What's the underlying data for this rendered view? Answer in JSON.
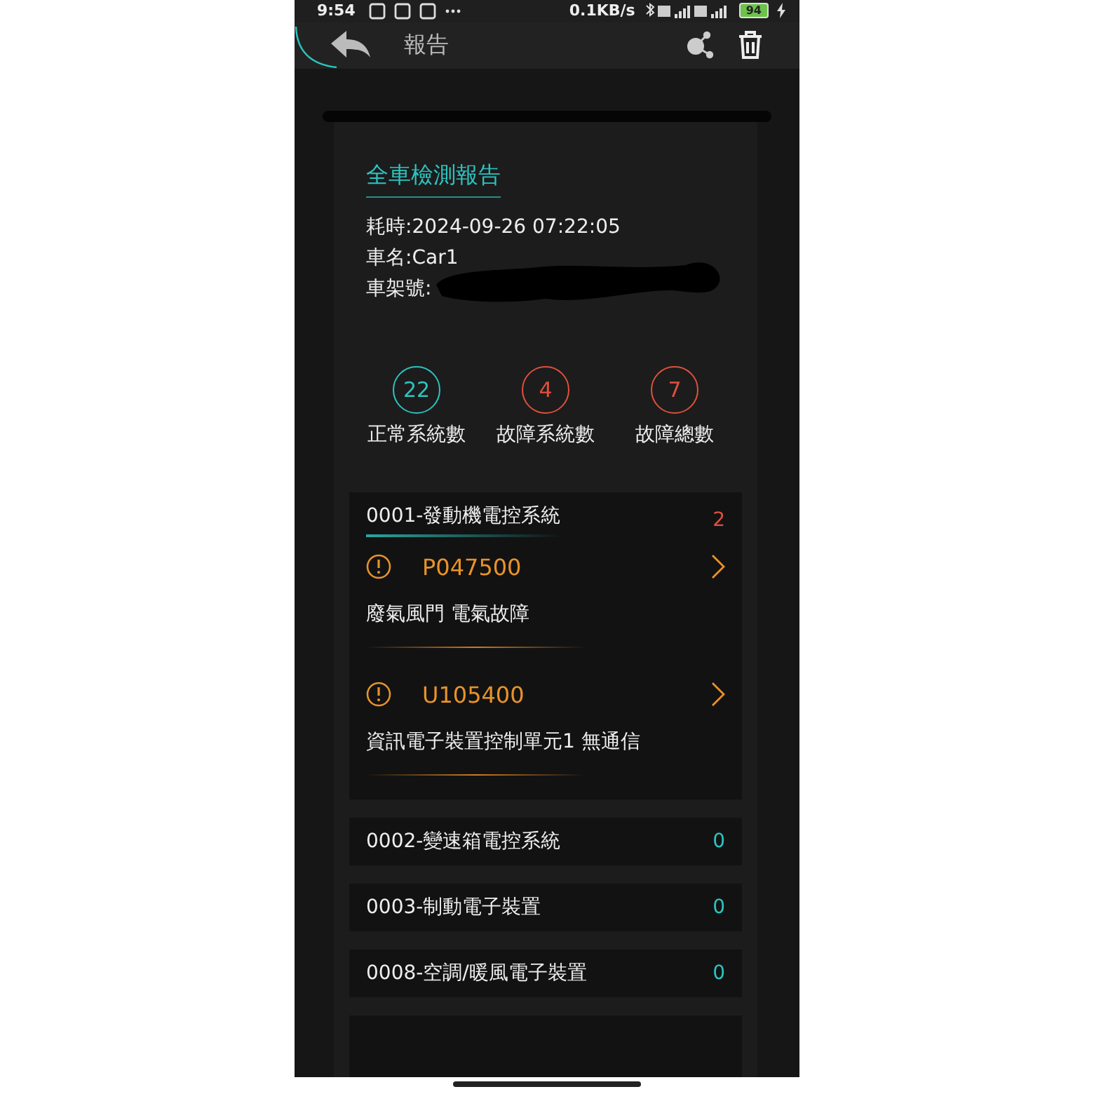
{
  "status_bar": {
    "time": "9:54",
    "network_speed": "0.1KB/s",
    "battery": "94"
  },
  "header": {
    "title": "報告"
  },
  "report": {
    "title": "全車檢測報告",
    "lines": [
      {
        "text": "耗時:2024-09-26 07:22:05",
        "redacted": false
      },
      {
        "text": "車名:Car1",
        "redacted": false
      },
      {
        "text": "車架號:",
        "redacted": true
      }
    ]
  },
  "stats": [
    {
      "value": "22",
      "label": "正常系統數",
      "kind": "ok"
    },
    {
      "value": "4",
      "label": "故障系統數",
      "kind": "fault"
    },
    {
      "value": "7",
      "label": "故障總數",
      "kind": "fault"
    }
  ],
  "systems": [
    {
      "name": "0001-發動機電控系統",
      "count": "2",
      "kind": "fault",
      "faults": [
        {
          "code": "P047500",
          "description": "廢氣風門 電氣故障"
        },
        {
          "code": "U105400",
          "description": "資訊電子裝置控制單元1 無通信"
        }
      ]
    },
    {
      "name": "0002-變速箱電控系統",
      "count": "0",
      "kind": "ok"
    },
    {
      "name": "0003-制動電子裝置",
      "count": "0",
      "kind": "ok"
    },
    {
      "name": "0008-空調/暖風電子裝置",
      "count": "0",
      "kind": "ok"
    }
  ]
}
